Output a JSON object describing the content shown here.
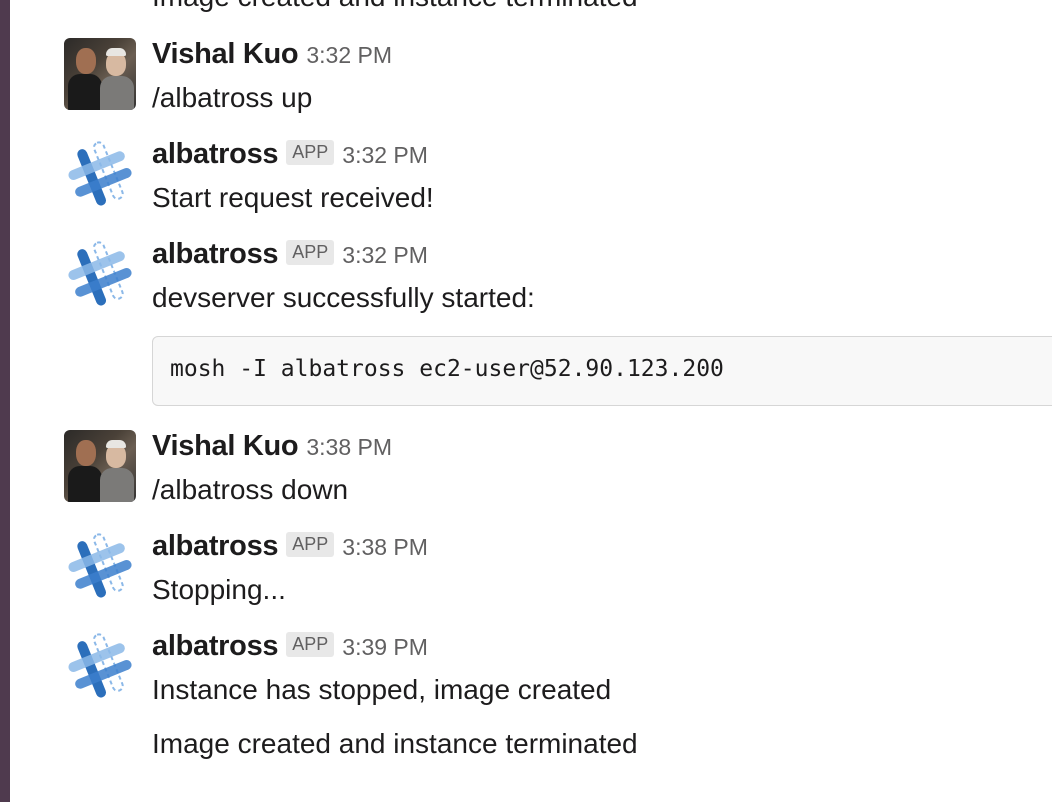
{
  "messages": [
    {
      "text": "Image created and instance terminated"
    },
    {
      "author": "Vishal Kuo",
      "time": "3:32 PM",
      "text": "/albatross up"
    },
    {
      "author": "albatross",
      "badge": "APP",
      "time": "3:32 PM",
      "text": "Start request received!"
    },
    {
      "author": "albatross",
      "badge": "APP",
      "time": "3:32 PM",
      "text": "devserver successfully started:",
      "code": "mosh -I albatross ec2-user@52.90.123.200"
    },
    {
      "author": "Vishal Kuo",
      "time": "3:38 PM",
      "text": "/albatross down"
    },
    {
      "author": "albatross",
      "badge": "APP",
      "time": "3:38 PM",
      "text": "Stopping..."
    },
    {
      "author": "albatross",
      "badge": "APP",
      "time": "3:39 PM",
      "text": "Instance has stopped, image created",
      "text2": "Image created and instance terminated"
    }
  ],
  "colors": {
    "sidebar": "#4f3a4e",
    "app_icon_dark": "#2c6fbb",
    "app_icon_light": "#8bb8e8"
  },
  "icons": {
    "user_avatar": "user-photo-avatar",
    "app_avatar": "albatross-app-icon"
  }
}
